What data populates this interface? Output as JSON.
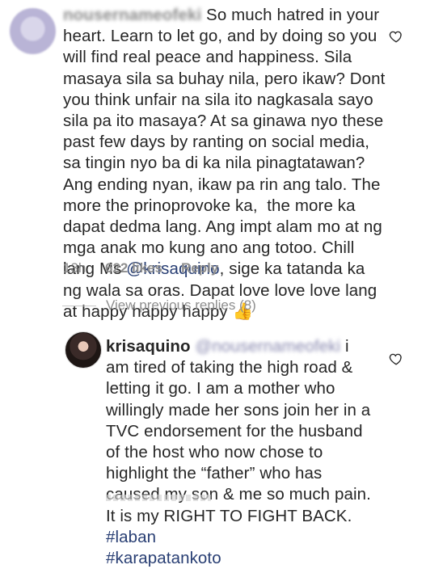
{
  "comment1": {
    "username": "nousernameofeki",
    "text": "So much hatred in your heart. Learn to let go, and by doing so you will find real peace and happiness. Sila masaya sila sa buhay nila, pero ikaw? Dont you think unfair na sila ito nagkasala sayo sila pa ito masaya? At sa ginawa nyo these past few days by ranting on social media, sa tingin nyo ba di ka nila pinagtatawan? Ang ending nyan, ikaw pa rin ang talo. The more the prinoprovoke ka,  the more ka dapat dedma lang. Ang impt alam mo at ng mga anak mo kung ano ang totoo. Chill lang Ms ",
    "mention": "@krisaquino",
    "text_after": ", sige ka tatanda ka ng wala sa oras. Dapat love love love lang at happy happy happy ",
    "emoji": "👍",
    "time": "13h",
    "likes": "622 likes",
    "reply_label": "Reply"
  },
  "view_replies": "View previous replies (8)",
  "comment2": {
    "username": "krisaquino",
    "mention": "@nousernameofeki",
    "text": " i am tired of taking the high road & letting it go. I am a mother who willingly made her sons join her in a TVC endorsement for the husband of the host who now chose to highlight the “father” who has caused my son & me so much pain. It is my RIGHT TO FIGHT BACK. ",
    "hashtag1": "#laban",
    "hashtag2": "#karapatankoto"
  },
  "colors": {
    "text": "#262626",
    "meta": "#8e8e8e",
    "link": "#283e73"
  }
}
